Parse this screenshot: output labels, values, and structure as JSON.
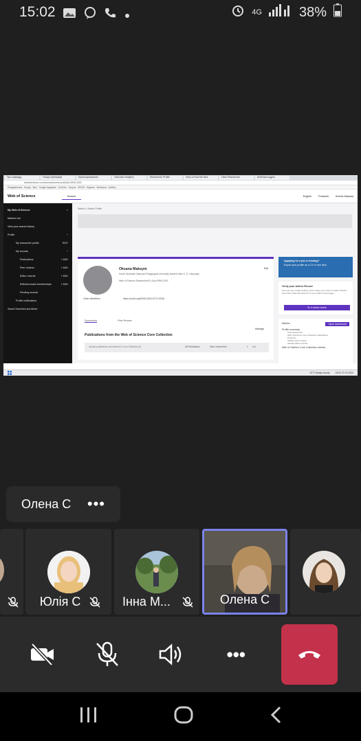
{
  "status_bar": {
    "time": "15:02",
    "network": "4G",
    "battery": "38%"
  },
  "shared_screen": {
    "browser_tabs": [
      "Про кафедру",
      "Пошук публікацій",
      "Мультицитування",
      "Clarivate Analytics",
      "Researcher Profile",
      "View of How Be Nice",
      "Cites Researcher",
      "Мобільна адрес"
    ],
    "address": "webofscience.com/wos/author/record/AAA-9999-2020",
    "bookmarks": "Повідомлення · Пошук · Wos · Google Академія · YouTube · Scopus · ORCID · Журнал · Мобільна · Гребінь",
    "wos": {
      "brand": "Web of Science",
      "search_tab": "Search",
      "lang": "English",
      "products": "Products",
      "user": "Ксенія Максим"
    },
    "sidebar": {
      "items": [
        {
          "label": "My Web of Science",
          "extra": "«"
        },
        {
          "label": "Marked List",
          "extra": ""
        },
        {
          "label": "View your search history",
          "extra": ""
        },
        {
          "label": "Profile",
          "extra": "^"
        },
        {
          "label": "My researcher profile",
          "extra": "EDIT"
        },
        {
          "label": "My records",
          "extra": "^"
        },
        {
          "label": "Publications",
          "extra": "+ ADD"
        },
        {
          "label": "Peer reviews",
          "extra": "+ ADD"
        },
        {
          "label": "Editor records",
          "extra": "+ ADD"
        },
        {
          "label": "Editorial board memberships",
          "extra": "+ ADD"
        },
        {
          "label": "Pending records",
          "extra": ""
        },
        {
          "label": "Profile notifications",
          "extra": ""
        },
        {
          "label": "Saved Searches and Alerts",
          "extra": ""
        }
      ]
    },
    "breadcrumb": "Search > Author Profile",
    "profile": {
      "name": "Oksana Maksym",
      "edit": "Edit",
      "affiliation": "South Ukrainian National Pedagogical University Named After K. D. Ushynsky",
      "rid": "Web of Science ResearcherID: AAA-9999-2020",
      "other_ids": "Other identifiers",
      "orcid": "https://orcid.org/0000-0002-0772-0236"
    },
    "tabs": [
      "Documents",
      "Peer Review"
    ],
    "pubs_title": "Publications from the Web of Science Core Collection",
    "manage": "Manage",
    "filter": {
      "include": "Include publications not indexed in Core Collection (0)",
      "all": "All Publications",
      "sort": "Date: newest first",
      "page": "1",
      "of": "of 1"
    },
    "right": {
      "applying_title": "Applying for a job or funding?",
      "applying_sub": "Export your profile as a CV in one click.",
      "verify_title": "Verify your Author Record",
      "verify_text": "Get your own verified author record. Enter your name in Author Search, then click \"Claim My Record\" on your author record page.",
      "verify_btn": "Go to author search",
      "metrics": "Metrics",
      "open_dash": "Open dashboard",
      "summary": "Profile summary",
      "summary_lines": [
        "Total documents",
        "Web of Science Core Collection publications",
        "Preprints",
        "Verified peer reviews",
        "Verified editor records"
      ],
      "core_metrics": "Web of Science Core Collection metrics"
    },
    "taskbar": {
      "weather": "22°C  Mostly cloudy",
      "clock": "15:02\n27.10.2022"
    }
  },
  "active_speaker": {
    "name": "Олена С",
    "more": "•••"
  },
  "participants": [
    {
      "name": "",
      "muted": true
    },
    {
      "name": "Юлія С",
      "muted": true
    },
    {
      "name": "Інна М...",
      "muted": true
    },
    {
      "name": "Олена С",
      "muted": false,
      "active": true
    },
    {
      "name": "",
      "muted": false
    }
  ],
  "controls": {
    "camera": "camera-off",
    "mic": "mic-off",
    "speaker": "speaker-on",
    "more": "•••",
    "hangup": "hang-up"
  },
  "colors": {
    "background": "#1f1f1f",
    "tile": "#2b2b2b",
    "accent": "#7b83eb",
    "hangup": "#c4314b",
    "wos_purple": "#5e33bf"
  }
}
